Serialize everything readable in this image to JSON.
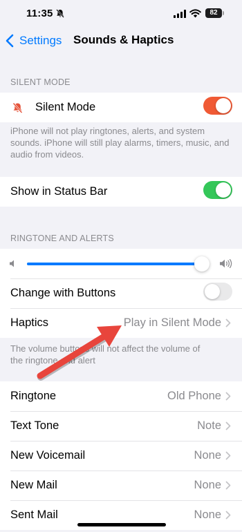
{
  "status_bar": {
    "time": "11:35",
    "battery": "82",
    "icons": [
      "bell-slash-icon",
      "cellular-signal-icon",
      "wifi-icon",
      "battery-icon"
    ]
  },
  "nav": {
    "back_label": "Settings",
    "title": "Sounds & Haptics"
  },
  "silent_section": {
    "header": "SILENT MODE",
    "silent_mode_label": "Silent Mode",
    "silent_mode_on": true,
    "footer": "iPhone will not play ringtones, alerts, and system sounds. iPhone will still play alarms, timers, music, and audio from videos.",
    "status_bar_label": "Show in Status Bar",
    "status_bar_on": true
  },
  "ringtone_section": {
    "header": "RINGTONE AND ALERTS",
    "volume_level": 0.99,
    "change_with_buttons_label": "Change with Buttons",
    "change_with_buttons_on": false,
    "haptics_label": "Haptics",
    "haptics_value": "Play in Silent Mode",
    "footer_line1": "The volume buttons will not affect the volume of",
    "footer_line2": "the ringtone and alert"
  },
  "sounds_list": [
    {
      "label": "Ringtone",
      "value": "Old Phone"
    },
    {
      "label": "Text Tone",
      "value": "Note"
    },
    {
      "label": "New Voicemail",
      "value": "None"
    },
    {
      "label": "New Mail",
      "value": "None"
    },
    {
      "label": "Sent Mail",
      "value": "None"
    }
  ],
  "colors": {
    "accent": "#007aff",
    "silent_toggle": "#f05a35",
    "status_bar_toggle": "#34c759",
    "annotation_arrow": "#e8453c"
  }
}
